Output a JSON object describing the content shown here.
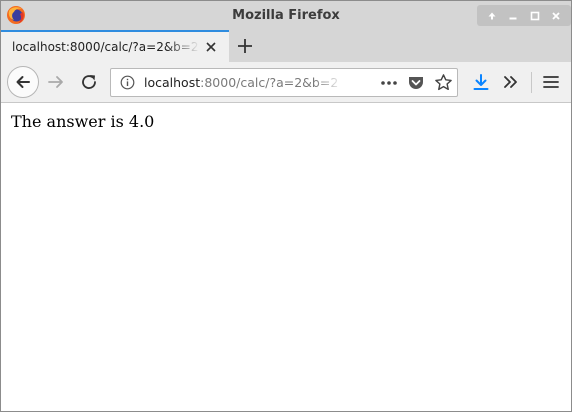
{
  "window": {
    "title": "Mozilla Firefox"
  },
  "tab": {
    "title": "localhost:8000/calc/?a=2&b=2",
    "active_accent": "#2f8cdf"
  },
  "urlbar": {
    "host": "localhost",
    "rest": ":8000/calc/?a=2&b=2"
  },
  "icons": {
    "app": "firefox-logo",
    "window_buttons": [
      "up-arrow-icon",
      "minimize-icon",
      "maximize-icon",
      "close-icon"
    ],
    "nav": [
      "back-arrow-icon",
      "forward-arrow-icon",
      "reload-icon"
    ],
    "urlbar": [
      "info-icon",
      "page-actions-icon",
      "pocket-icon",
      "bookmark-star-icon"
    ],
    "toolbar": [
      "download-icon",
      "overflow-chevron-icon",
      "hamburger-menu-icon"
    ]
  },
  "colors": {
    "download_accent": "#0a84ff"
  },
  "page": {
    "text": "The answer is 4.0"
  }
}
